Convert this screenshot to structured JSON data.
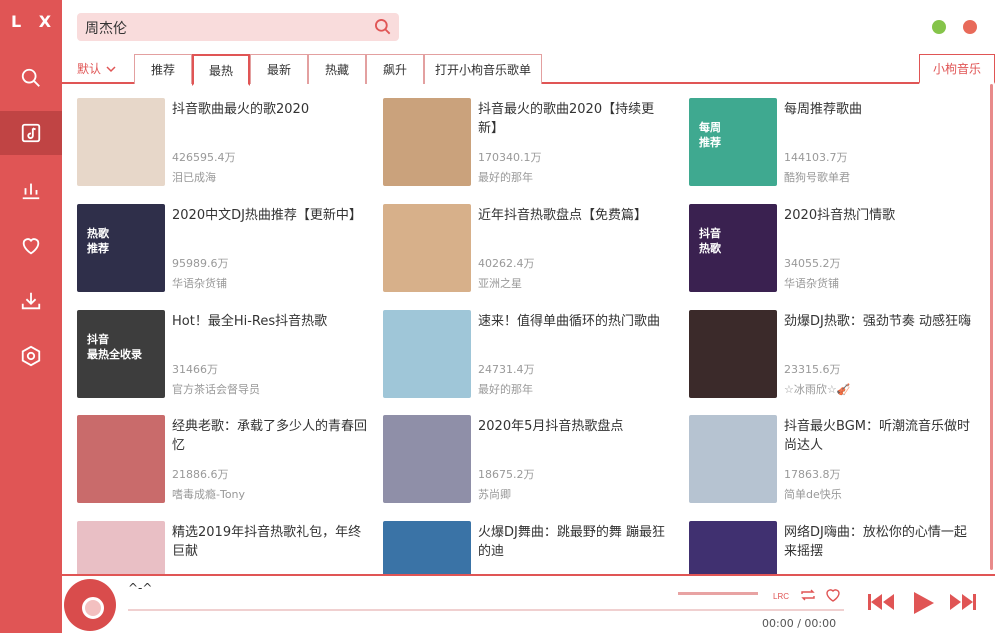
{
  "app": {
    "logo": "L X"
  },
  "sidebar": {
    "items": [
      {
        "name": "search-icon"
      },
      {
        "name": "music-note-icon",
        "active": true
      },
      {
        "name": "bar-chart-icon"
      },
      {
        "name": "heart-icon"
      },
      {
        "name": "download-icon"
      },
      {
        "name": "settings-icon"
      }
    ]
  },
  "search": {
    "value": "周杰伦"
  },
  "window": {
    "min_color": "#85c44a",
    "close_color": "#e86a5a"
  },
  "sort": {
    "selected": "默认"
  },
  "tabs": [
    {
      "label": "推荐"
    },
    {
      "label": "最热",
      "active": true
    },
    {
      "label": "最新"
    },
    {
      "label": "热藏"
    },
    {
      "label": "飙升"
    },
    {
      "label": "打开小枸音乐歌单"
    }
  ],
  "source_tab": {
    "label": "小枸音乐"
  },
  "playlists": [
    {
      "title": "抖音歌曲最火的歌2020",
      "count": "426595.4万",
      "author": "泪已成海",
      "thumb": "#e7d7c9"
    },
    {
      "title": "抖音最火的歌曲2020【持续更新】",
      "count": "170340.1万",
      "author": "最好的那年",
      "thumb": "#caa27c"
    },
    {
      "title": "每周推荐歌曲",
      "count": "144103.7万",
      "author": "酷狗号歌单君",
      "thumb": "#3fa990",
      "label": "每周\n推荐"
    },
    {
      "title": "2020中文DJ热曲推荐【更新中】",
      "count": "95989.6万",
      "author": "华语杂货铺",
      "thumb": "#2f2f4a",
      "label": "热歌\n推荐"
    },
    {
      "title": "近年抖音热歌盘点【免费篇】",
      "count": "40262.4万",
      "author": "亚洲之星",
      "thumb": "#d7b08a"
    },
    {
      "title": "2020抖音热门情歌",
      "count": "34055.2万",
      "author": "华语杂货铺",
      "thumb": "#3a2150",
      "label": "抖音\n热歌"
    },
    {
      "title": "Hot！最全Hi-Res抖音热歌",
      "count": "31466万",
      "author": "官方茶话会督导员",
      "thumb": "#3d3d3d",
      "label": "抖音\n最热全收录"
    },
    {
      "title": "速来！值得单曲循环的热门歌曲",
      "count": "24731.4万",
      "author": "最好的那年",
      "thumb": "#9fc6d8"
    },
    {
      "title": "劲爆DJ热歌：强劲节奏 动感狂嗨",
      "count": "23315.6万",
      "author": "☆冰雨欣☆🎻",
      "thumb": "#3b2a2a"
    },
    {
      "title": "经典老歌：承载了多少人的青春回忆",
      "count": "21886.6万",
      "author": "嗜毒成瘾-Tony",
      "thumb": "#c96b6b"
    },
    {
      "title": "2020年5月抖音热歌盘点",
      "count": "18675.2万",
      "author": "苏尚卿",
      "thumb": "#8f8fa8"
    },
    {
      "title": "抖音最火BGM：听潮流音乐做时尚达人",
      "count": "17863.8万",
      "author": "简单de快乐",
      "thumb": "#b6c3d1"
    },
    {
      "title": "精选2019年抖音热歌礼包，年终巨献",
      "count": "",
      "author": "",
      "thumb": "#e9bfc5"
    },
    {
      "title": "火爆DJ舞曲：跳最野的舞 蹦最狂的迪",
      "count": "",
      "author": "",
      "thumb": "#3a73a6"
    },
    {
      "title": "网络DJ嗨曲：放松你的心情一起来摇摆",
      "count": "",
      "author": "",
      "thumb": "#403070"
    }
  ],
  "player": {
    "track": "^-^",
    "time": "00:00 / 00:00",
    "lrc_label": "LRC",
    "accent": "#e05555"
  }
}
